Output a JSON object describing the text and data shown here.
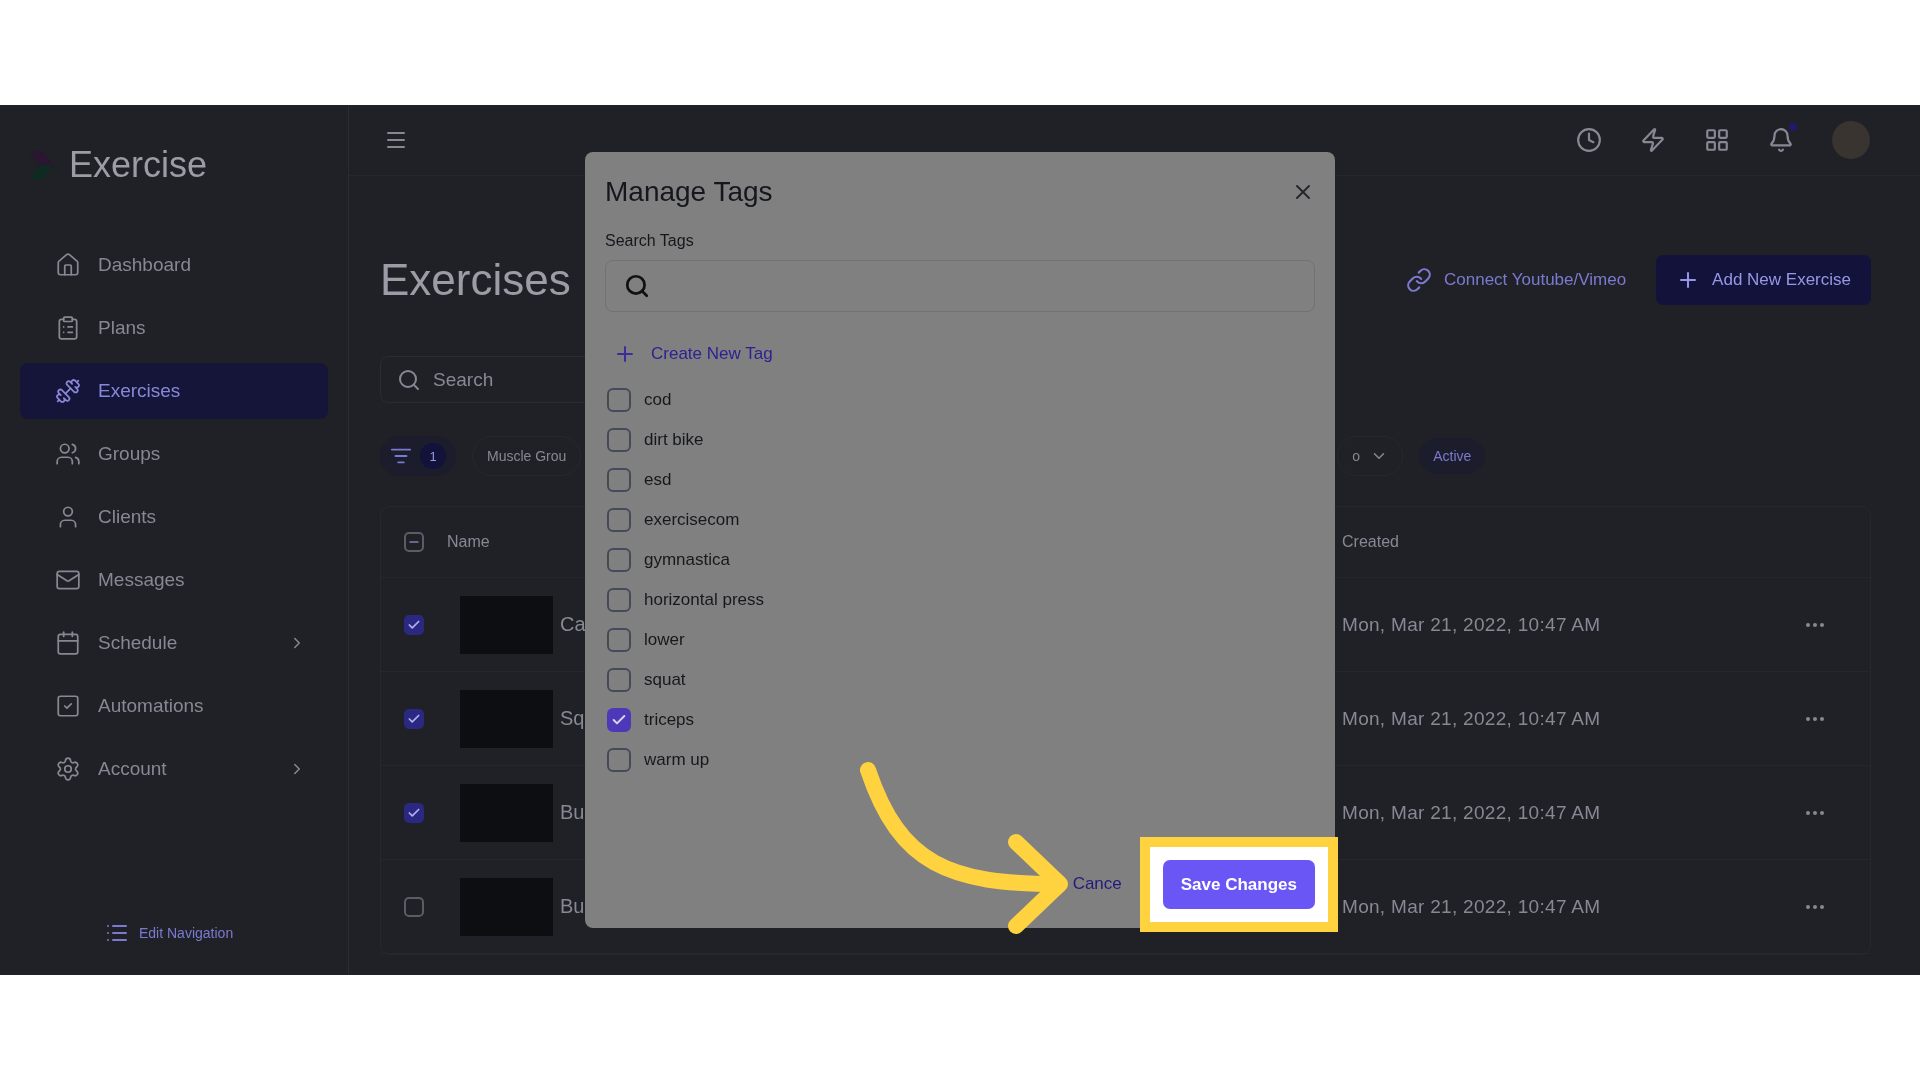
{
  "sidebar": {
    "brand": "Exercise",
    "items": [
      {
        "label": "Dashboard",
        "selected": false,
        "expandable": false
      },
      {
        "label": "Plans",
        "selected": false,
        "expandable": false
      },
      {
        "label": "Exercises",
        "selected": true,
        "expandable": false
      },
      {
        "label": "Groups",
        "selected": false,
        "expandable": false
      },
      {
        "label": "Clients",
        "selected": false,
        "expandable": false
      },
      {
        "label": "Messages",
        "selected": false,
        "expandable": false
      },
      {
        "label": "Schedule",
        "selected": false,
        "expandable": true
      },
      {
        "label": "Automations",
        "selected": false,
        "expandable": false
      },
      {
        "label": "Account",
        "selected": false,
        "expandable": true
      }
    ],
    "edit_navigation": "Edit Navigation"
  },
  "page": {
    "title": "Exercises",
    "connect_link": "Connect Youtube/Vimeo",
    "add_button": "Add New Exercise",
    "search_placeholder": "Search",
    "filter_count": "1",
    "filters": [
      "Muscle Grou",
      "o"
    ],
    "status_chip": "Active"
  },
  "table": {
    "columns": [
      "Name",
      "Created"
    ],
    "select_all_indeterminate": true,
    "rows": [
      {
        "name": "Ca",
        "created": "Mon, Mar 21, 2022, 10:47 AM",
        "selected": true
      },
      {
        "name": "Sq",
        "created": "Mon, Mar 21, 2022, 10:47 AM",
        "selected": true
      },
      {
        "name": "Bu",
        "created": "Mon, Mar 21, 2022, 10:47 AM",
        "selected": true
      },
      {
        "name": "Bu",
        "created": "Mon, Mar 21, 2022, 10:47 AM",
        "selected": false
      }
    ]
  },
  "modal": {
    "title": "Manage Tags",
    "search_label": "Search Tags",
    "create_link": "Create New Tag",
    "tags": [
      {
        "label": "cod",
        "checked": false
      },
      {
        "label": "dirt bike",
        "checked": false
      },
      {
        "label": "esd",
        "checked": false
      },
      {
        "label": "exercisecom",
        "checked": false
      },
      {
        "label": "gymnastica",
        "checked": false
      },
      {
        "label": "horizontal press",
        "checked": false
      },
      {
        "label": "lower",
        "checked": false
      },
      {
        "label": "squat",
        "checked": false
      },
      {
        "label": "triceps",
        "checked": true
      },
      {
        "label": "warm up",
        "checked": false
      }
    ],
    "cancel": "Cance",
    "save": "Save Changes",
    "save_highlighted": true
  }
}
